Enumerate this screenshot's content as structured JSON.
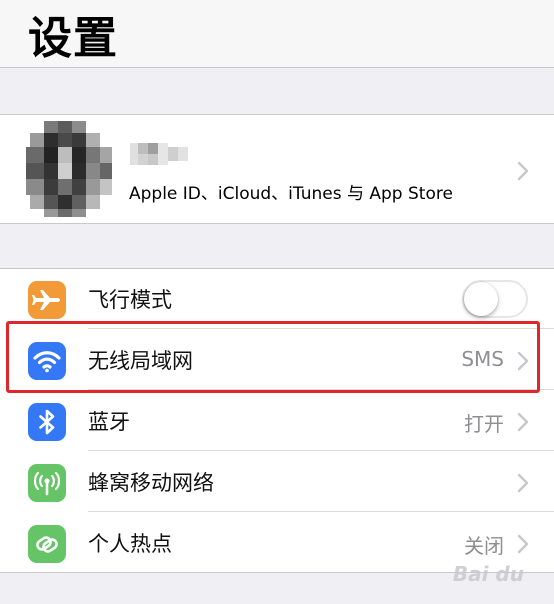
{
  "header": {
    "title": "设置"
  },
  "profile": {
    "subtitle": "Apple ID、iCloud、iTunes 与 App Store"
  },
  "settings": {
    "rows": [
      {
        "label": "飞行模式",
        "icon": "airplane-icon",
        "icon_color": "#f19a37",
        "toggle": "off"
      },
      {
        "label": "无线局域网",
        "icon": "wifi-icon",
        "icon_color": "#3478f6",
        "value": "SMS"
      },
      {
        "label": "蓝牙",
        "icon": "bluetooth-icon",
        "icon_color": "#3478f6",
        "value": "打开"
      },
      {
        "label": "蜂窝移动网络",
        "icon": "cellular-antenna-icon",
        "icon_color": "#65c466"
      },
      {
        "label": "个人热点",
        "icon": "personal-hotspot-icon",
        "icon_color": "#65c466",
        "value": "关闭"
      }
    ]
  },
  "highlight_color": "#e0262b"
}
